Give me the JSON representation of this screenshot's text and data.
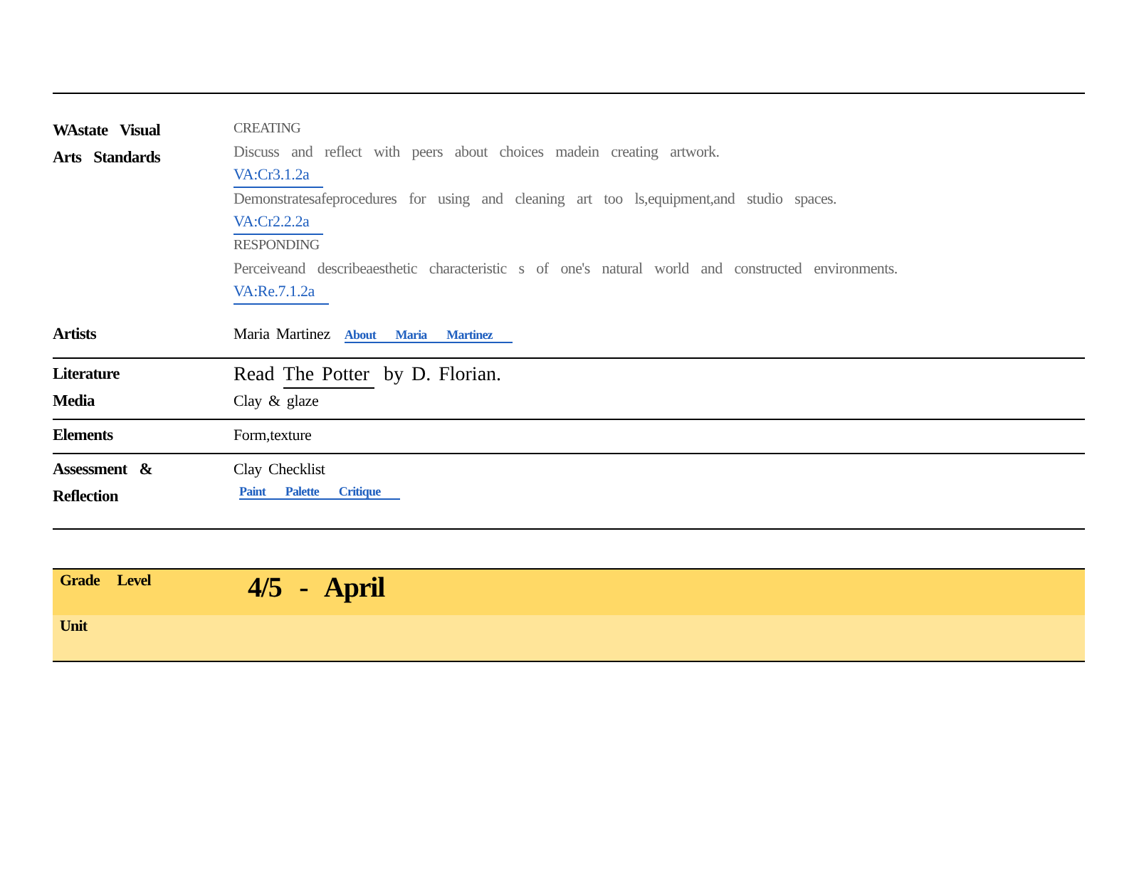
{
  "plan_table": {
    "sections": [
      {
        "rows": [
          {
            "label": "WAstate Visual Arts Standards",
            "lines": [
              {
                "segments": [
                  {
                    "kind": "heading",
                    "text": "CREATING"
                  }
                ]
              },
              {
                "segments": [
                  {
                    "kind": "body",
                    "text": "Discuss and reflect with peers about choices madein creating artwork."
                  }
                ]
              },
              {
                "segments": [
                  {
                    "kind": "link",
                    "text": "VA:Cr3.1.2a"
                  }
                ]
              },
              {
                "segments": [
                  {
                    "kind": "body",
                    "text": "Demonstratesafeprocedures for using and cleaning art too ls,equipment,and studio spaces."
                  }
                ]
              },
              {
                "segments": [
                  {
                    "kind": "link",
                    "text": "VA:Cr2.2.2a"
                  }
                ]
              },
              {
                "segments": [
                  {
                    "kind": "heading",
                    "text": "RESPONDING"
                  }
                ]
              },
              {
                "segments": [
                  {
                    "kind": "body",
                    "text": "Perceiveand describeaesthetic characteristic s of one's natural world and constructed environments."
                  }
                ]
              },
              {
                "segments": [
                  {
                    "kind": "link",
                    "text": "VA:Re.7.1.2a"
                  }
                ]
              }
            ]
          },
          {
            "label": "Artists",
            "lines": [
              {
                "segments": [
                  {
                    "kind": "plain",
                    "text": "Maria Martinez"
                  },
                  {
                    "kind": "small-link",
                    "text": "About Maria Martinez"
                  }
                ]
              }
            ]
          }
        ]
      },
      {
        "rows": [
          {
            "label": "Literature",
            "lines": [
              {
                "segments": [
                  {
                    "kind": "large",
                    "text": "Read"
                  },
                  {
                    "kind": "large-link",
                    "text": "The Potter"
                  },
                  {
                    "kind": "large",
                    "text": "by D. Florian."
                  }
                ]
              }
            ]
          },
          {
            "label": "Media",
            "lines": [
              {
                "segments": [
                  {
                    "kind": "plain",
                    "text": "Clay & glaze"
                  }
                ]
              }
            ]
          }
        ]
      },
      {
        "rows": [
          {
            "label": "Elements",
            "lines": [
              {
                "segments": [
                  {
                    "kind": "plain",
                    "text": "Form,texture"
                  }
                ]
              }
            ]
          }
        ]
      },
      {
        "rows": [
          {
            "label": "Assessment & Reflection",
            "lines": [
              {
                "segments": [
                  {
                    "kind": "plain",
                    "text": "Clay Checklist"
                  }
                ]
              },
              {
                "segments": [
                  {
                    "kind": "small-link",
                    "text": "Paint Palette Critique"
                  }
                ]
              }
            ]
          }
        ]
      }
    ]
  },
  "grade_table": {
    "rows": [
      {
        "label": "Grade Level",
        "value": "4/5 - April",
        "color": "#ffd966"
      },
      {
        "label": "Unit",
        "color": "#ffe599"
      }
    ]
  }
}
